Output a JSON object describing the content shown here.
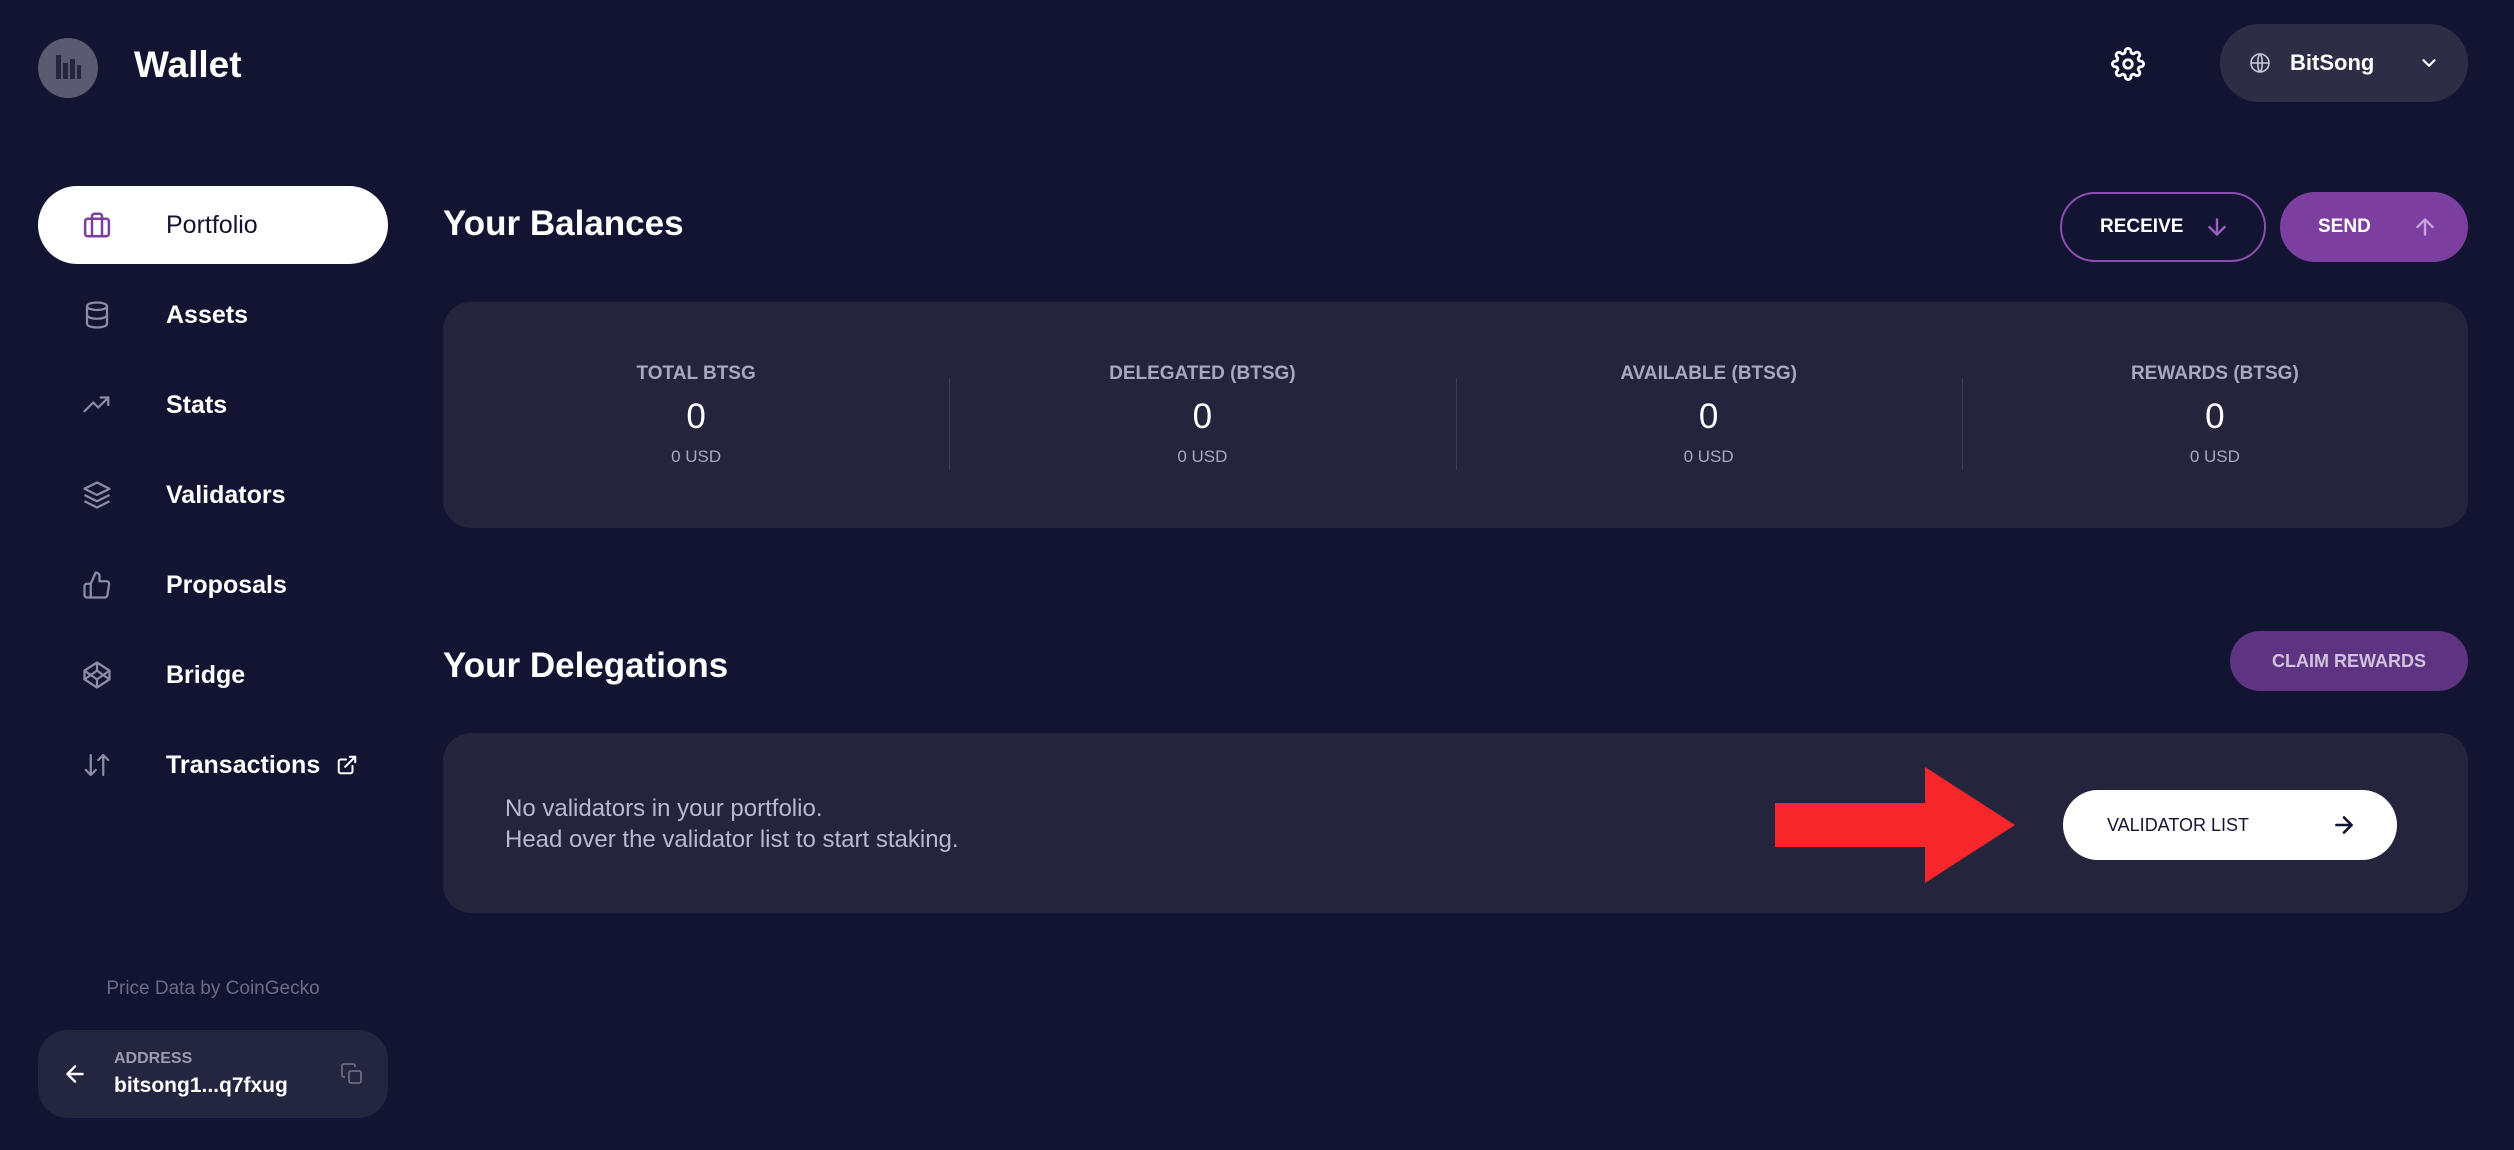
{
  "header": {
    "app_title": "Wallet",
    "network": {
      "label": "BitSong"
    }
  },
  "sidebar": {
    "items": [
      {
        "label": "Portfolio",
        "icon": "briefcase-icon",
        "active": true
      },
      {
        "label": "Assets",
        "icon": "database-icon",
        "active": false
      },
      {
        "label": "Stats",
        "icon": "trending-up-icon",
        "active": false
      },
      {
        "label": "Validators",
        "icon": "layers-icon",
        "active": false
      },
      {
        "label": "Proposals",
        "icon": "thumbs-up-icon",
        "active": false
      },
      {
        "label": "Bridge",
        "icon": "codepen-icon",
        "active": false
      },
      {
        "label": "Transactions",
        "icon": "swap-icon",
        "active": false
      }
    ],
    "price_data": "Price Data by CoinGecko",
    "address": {
      "label": "ADDRESS",
      "value": "bitsong1...q7fxug"
    }
  },
  "balances": {
    "title": "Your Balances",
    "receive_label": "RECEIVE",
    "send_label": "SEND",
    "cards": [
      {
        "label": "TOTAL BTSG",
        "value": "0",
        "usd": "0 USD"
      },
      {
        "label": "DELEGATED (BTSG)",
        "value": "0",
        "usd": "0 USD"
      },
      {
        "label": "AVAILABLE (BTSG)",
        "value": "0",
        "usd": "0 USD"
      },
      {
        "label": "REWARDS (BTSG)",
        "value": "0",
        "usd": "0 USD"
      }
    ]
  },
  "delegations": {
    "title": "Your Delegations",
    "claim_label": "CLAIM REWARDS",
    "empty_line1": "No validators in your portfolio.",
    "empty_line2": "Head over the validator list to start staking.",
    "validator_list_label": "VALIDATOR LIST"
  },
  "colors": {
    "background": "#131431",
    "card": "#24243c",
    "accent": "#7b3fa0",
    "annotation_arrow": "#f5272a"
  }
}
